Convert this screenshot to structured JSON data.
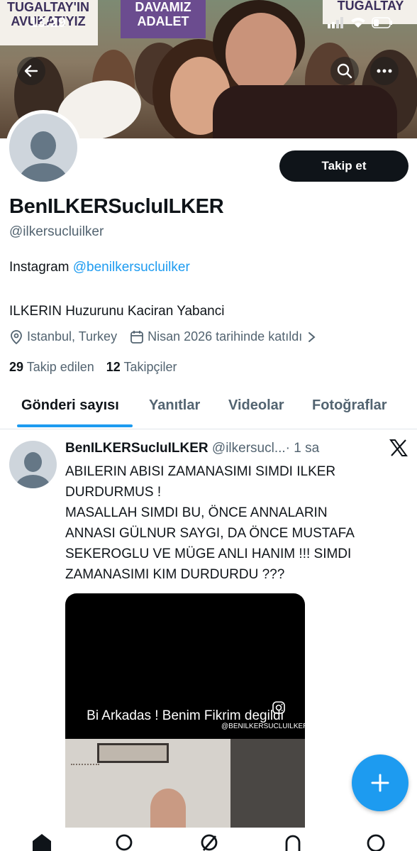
{
  "status_bar": {
    "time": "13:29"
  },
  "banner": {
    "sign_left": "TUGALTAY'IN AVUKATIYIZ",
    "sign_center_top": "DAVAMIZ",
    "sign_center_bottom": "ADALET",
    "sign_right": "TUGALTAY"
  },
  "profile": {
    "display_name": "BenILKERSucluILKER",
    "handle": "@ilkersucluilker",
    "follow_label": "Takip et",
    "bio_prefix": "Instagram ",
    "bio_link": "@benilkersucluilker",
    "bio_line2": "ILKERIN Huzurunu Kaciran Yabanci",
    "location": "Istanbul, Turkey",
    "joined": "Nisan 2026 tarihinde katıldı",
    "following_count": "29",
    "following_label": "Takip edilen",
    "followers_count": "12",
    "followers_label": "Takipçiler"
  },
  "tabs": [
    {
      "label": "Gönderi sayısı"
    },
    {
      "label": "Yanıtlar"
    },
    {
      "label": "Videolar"
    },
    {
      "label": "Fotoğraflar"
    }
  ],
  "tweet": {
    "name": "BenILKERSucluILKER",
    "handle": "@ilkersucl...",
    "time": "· 1 sa",
    "lines": [
      "ABILERIN ABISI ZAMANASIMI SIMDI ILKER",
      "DURDURMUS !",
      "MASALLAH SIMDI BU, ÖNCE ANNALARIN",
      "ANNASI GÜLNUR SAYGI, DA ÖNCE MUSTAFA",
      "SEKEROGLU VE MÜGE ANLI HANIM !!! SIMDI",
      "ZAMANASIMI KIM DURDURDU ???"
    ],
    "media_caption": "Bi Arkadas ! Benim Fikrim degildi",
    "media_watermark": "@BENILKERSUCLUILKER"
  },
  "icons": {
    "back": "back-arrow-icon",
    "search": "search-icon",
    "more": "more-icon",
    "location": "location-pin-icon",
    "calendar": "calendar-icon",
    "chevron": "chevron-right-icon",
    "x": "x-logo-icon",
    "fab": "plus-icon"
  },
  "colors": {
    "accent": "#1d9bf0",
    "text_primary": "#0f1419",
    "text_secondary": "#536471"
  }
}
